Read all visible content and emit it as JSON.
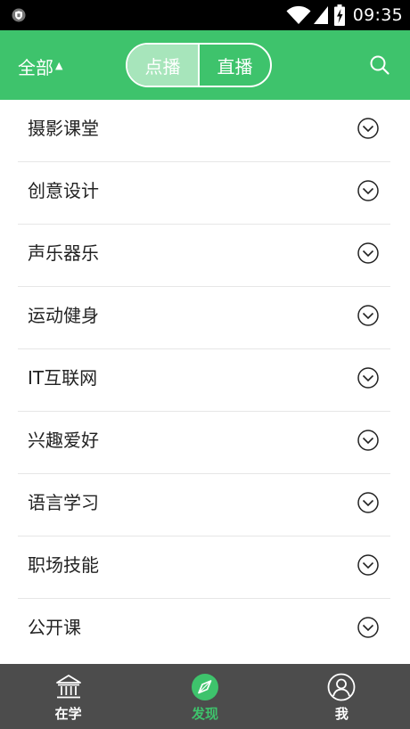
{
  "status_bar": {
    "time": "09:35",
    "icons": [
      "shield-icon",
      "wifi-icon",
      "signal-icon",
      "battery-charging-icon"
    ]
  },
  "header": {
    "filter_label": "全部",
    "filter_caret": "▲",
    "tabs": [
      {
        "label": "点播",
        "active": true
      },
      {
        "label": "直播",
        "active": false
      }
    ],
    "search_icon": "search-icon",
    "background_color": "#3ec36c"
  },
  "categories": [
    {
      "label": "摄影课堂"
    },
    {
      "label": "创意设计"
    },
    {
      "label": "声乐器乐"
    },
    {
      "label": "运动健身"
    },
    {
      "label": "IT互联网"
    },
    {
      "label": "兴趣爱好"
    },
    {
      "label": "语言学习"
    },
    {
      "label": "职场技能"
    },
    {
      "label": "公开课"
    }
  ],
  "bottom_nav": {
    "items": [
      {
        "label": "在学",
        "icon": "institution-icon",
        "active": false
      },
      {
        "label": "发现",
        "icon": "compass-icon",
        "active": true
      },
      {
        "label": "我",
        "icon": "user-icon",
        "active": false
      }
    ],
    "active_color": "#3ec36c"
  }
}
